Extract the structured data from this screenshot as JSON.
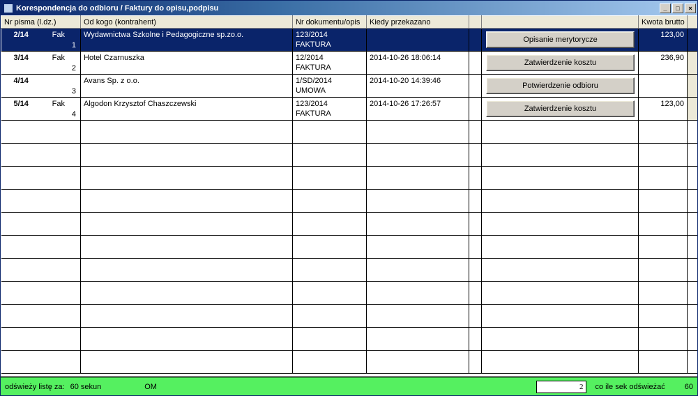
{
  "window": {
    "title": "Korespondencja do odbioru / Faktury do opisu,podpisu",
    "btnMin": "_",
    "btnMax": "□",
    "btnClose": "×"
  },
  "headers": {
    "nr": "Nr pisma (l.dz.)",
    "kogo": "Od kogo (kontrahent)",
    "doc": "Nr dokumentu/opis",
    "kiedy": "Kiedy przekazano",
    "btn": "",
    "brutto": "Kwota brutto"
  },
  "rows": [
    {
      "nr": "2/14",
      "fak": "Fak",
      "seq": "1",
      "kogo": "Wydawnictwa Szkolne i Pedagogiczne sp.zo.o.",
      "doc1": "123/2014",
      "doc2": "FAKTURA",
      "kiedy": "",
      "btn": "Opisanie merytorycze",
      "brutto": "123,00",
      "selected": true
    },
    {
      "nr": "3/14",
      "fak": "Fak",
      "seq": "2",
      "kogo": "Hotel Czarnuszka",
      "doc1": "12/2014",
      "doc2": "FAKTURA",
      "kiedy": "2014-10-26 18:06:14",
      "btn": "Zatwierdzenie kosztu",
      "brutto": "236,90",
      "selected": false
    },
    {
      "nr": "4/14",
      "fak": "",
      "seq": "3",
      "kogo": "Avans Sp. z o.o.",
      "doc1": "1/SD/2014",
      "doc2": "UMOWA",
      "kiedy": "2014-10-20 14:39:46",
      "btn": "Potwierdzenie odbioru",
      "brutto": "",
      "selected": false
    },
    {
      "nr": "5/14",
      "fak": "Fak",
      "seq": "4",
      "kogo": "Algodon Krzysztof Chaszczewski",
      "doc1": "123/2014",
      "doc2": "FAKTURA",
      "kiedy": "2014-10-26 17:26:57",
      "btn": "Zatwierdzenie kosztu",
      "brutto": "123,00",
      "selected": false
    }
  ],
  "status": {
    "refreshListLabel": "odświeży listę za:",
    "refreshListValue": "60 sekun",
    "userCode": "OM",
    "intervalInput": "2",
    "intervalLabel": "co ile sek odświeżać",
    "intervalValue": "60"
  }
}
